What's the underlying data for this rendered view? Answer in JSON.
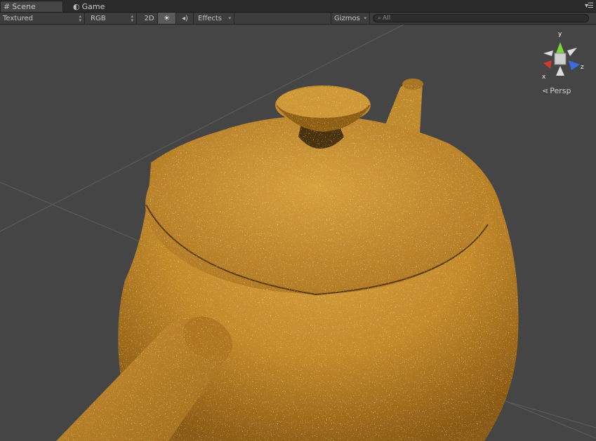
{
  "tabs": [
    {
      "label": "Scene",
      "icon": "grid-icon",
      "active": true
    },
    {
      "label": "Game",
      "icon": "pacman-icon",
      "active": false
    }
  ],
  "toolbar": {
    "render_mode": "Textured",
    "color_mode": "RGB",
    "toggle_2d": "2D",
    "lighting_icon": "sun-icon",
    "audio_icon": "speaker-icon",
    "effects_label": "Effects",
    "gizmos_label": "Gizmos",
    "search_placeholder": "All"
  },
  "gizmo": {
    "y_label": "y",
    "x_label": "x",
    "z_label": "z",
    "projection_label": "Persp"
  },
  "colors": {
    "object_main": "#c9912f",
    "object_dark": "#6a4510",
    "viewport_bg": "#454545",
    "axis_y": "#7bd63b",
    "axis_x": "#d23a2a",
    "axis_z": "#3b6be0"
  }
}
